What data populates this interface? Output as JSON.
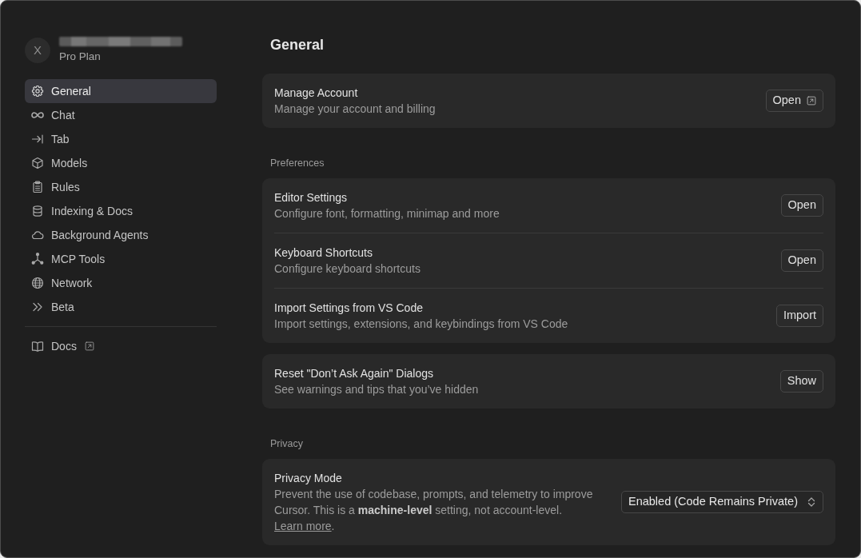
{
  "account": {
    "avatar_letter": "X",
    "name_blurred": true,
    "plan": "Pro Plan"
  },
  "sidebar": {
    "items": [
      {
        "label": "General",
        "selected": true
      },
      {
        "label": "Chat",
        "selected": false
      },
      {
        "label": "Tab",
        "selected": false
      },
      {
        "label": "Models",
        "selected": false
      },
      {
        "label": "Rules",
        "selected": false
      },
      {
        "label": "Indexing & Docs",
        "selected": false
      },
      {
        "label": "Background Agents",
        "selected": false
      },
      {
        "label": "MCP Tools",
        "selected": false
      },
      {
        "label": "Network",
        "selected": false
      },
      {
        "label": "Beta",
        "selected": false
      }
    ],
    "footer_items": [
      {
        "label": "Docs",
        "external": true
      }
    ]
  },
  "page_title": "General",
  "groups": [
    {
      "rows": [
        {
          "title": "Manage Account",
          "description": "Manage your account and billing",
          "control": {
            "kind": "button",
            "label": "Open",
            "external": true
          }
        }
      ]
    },
    {
      "heading": "Preferences",
      "rows": [
        {
          "title": "Editor Settings",
          "description": "Configure font, formatting, minimap and more",
          "control": {
            "kind": "button",
            "label": "Open",
            "external": false
          }
        },
        {
          "title": "Keyboard Shortcuts",
          "description": "Configure keyboard shortcuts",
          "control": {
            "kind": "button",
            "label": "Open",
            "external": false
          }
        },
        {
          "title": "Import Settings from VS Code",
          "description": "Import settings, extensions, and keybindings from VS Code",
          "control": {
            "kind": "button",
            "label": "Import",
            "external": false
          }
        }
      ]
    },
    {
      "rows": [
        {
          "title": "Reset \"Don’t Ask Again\" Dialogs",
          "description": "See warnings and tips that you’ve hidden",
          "control": {
            "kind": "button",
            "label": "Show",
            "external": false
          }
        }
      ]
    },
    {
      "heading": "Privacy",
      "rows": [
        {
          "title": "Privacy Mode",
          "description": "Prevent the use of codebase, prompts, and telemetry to improve Cursor. This is a **machine-level** setting, not account-level.",
          "link": "Learn more",
          "link_suffix": ".",
          "control": {
            "kind": "select",
            "value": "Enabled (Code Remains Private)"
          }
        }
      ]
    }
  ]
}
